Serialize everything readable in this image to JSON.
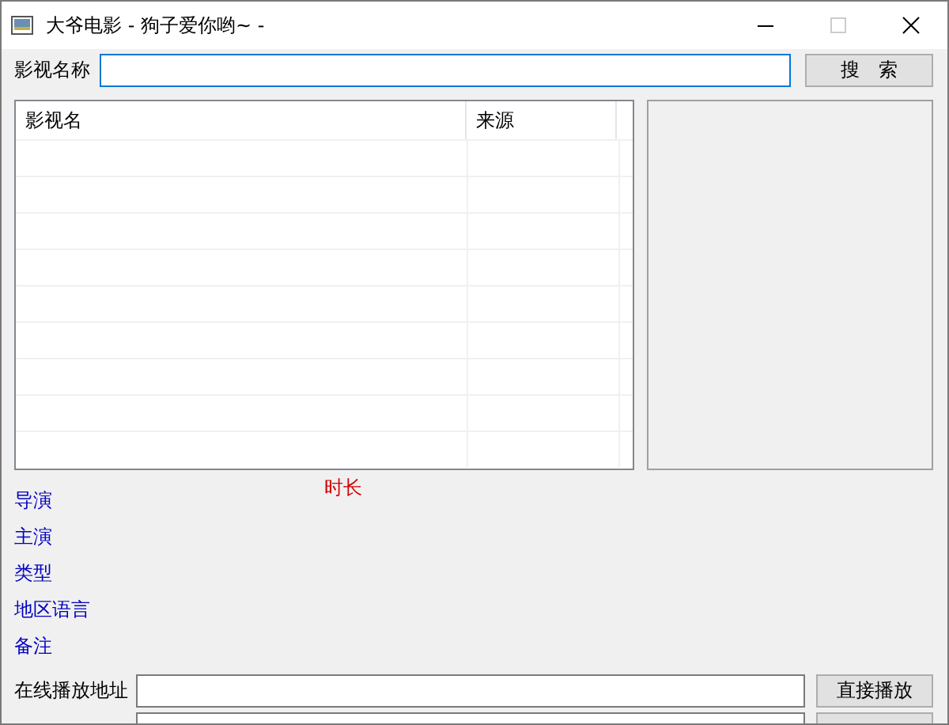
{
  "window": {
    "title": "大爷电影 - 狗子爱你哟~ -",
    "maximize_disabled": true
  },
  "search": {
    "label": "影视名称",
    "button": "搜　索"
  },
  "results": {
    "columns": [
      "影视名",
      "来源"
    ]
  },
  "duration_label": "时长",
  "details": [
    "导演",
    "主演",
    "类型",
    "地区语言",
    "备注"
  ],
  "online": {
    "label": "在线播放地址",
    "button": "直接播放"
  }
}
